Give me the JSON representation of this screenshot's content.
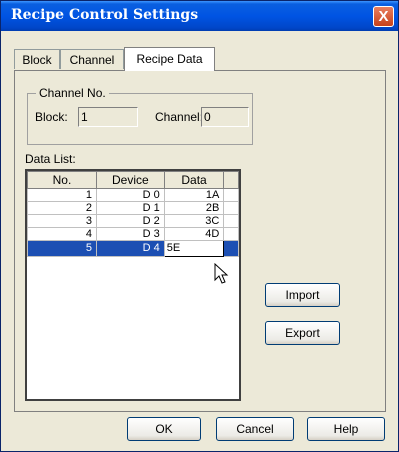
{
  "window": {
    "title": "Recipe Control Settings",
    "close_glyph": "X"
  },
  "tabs": [
    {
      "label": "Block"
    },
    {
      "label": "Channel"
    },
    {
      "label": "Recipe Data",
      "active": true
    }
  ],
  "channel_group": {
    "title": "Channel No.",
    "block_label": "Block:",
    "block_value": "1",
    "channel_label": "Channel:",
    "channel_value": "0"
  },
  "data_list": {
    "label": "Data List:",
    "columns": [
      "No.",
      "Device",
      "Data"
    ],
    "rows": [
      {
        "no": "1",
        "device": "D 0",
        "data": "1A"
      },
      {
        "no": "2",
        "device": "D 1",
        "data": "2B"
      },
      {
        "no": "3",
        "device": "D 2",
        "data": "3C"
      },
      {
        "no": "4",
        "device": "D 3",
        "data": "4D"
      },
      {
        "no": "5",
        "device": "D 4",
        "data": "5E",
        "selected": true,
        "editing": true
      }
    ]
  },
  "side_buttons": {
    "import": "Import",
    "export": "Export"
  },
  "footer_buttons": {
    "ok": "OK",
    "cancel": "Cancel",
    "help": "Help"
  },
  "colors": {
    "title_bar": "#0054e3",
    "selection": "#1c4fb3",
    "dialog_bg": "#ece9d8"
  },
  "icons": {
    "close": "close-icon",
    "pointer": "mouse-pointer-icon"
  }
}
